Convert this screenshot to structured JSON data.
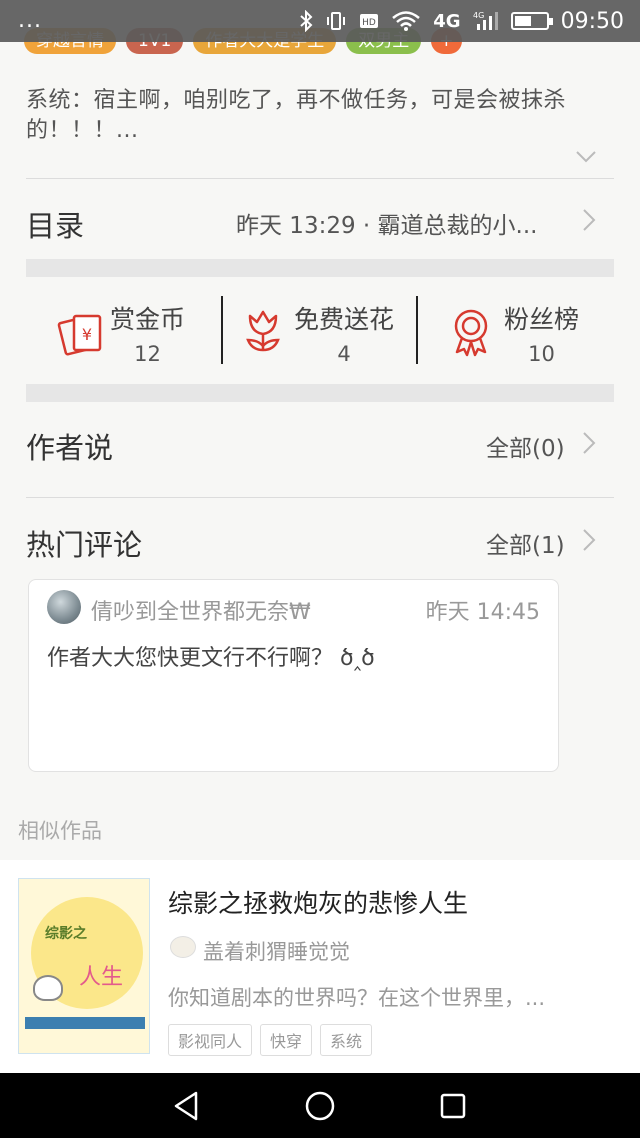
{
  "status_bar": {
    "dots": "...",
    "network_1": "4G",
    "network_2": "4G",
    "time": "09:50"
  },
  "tags": [
    {
      "label": "穿越言情",
      "color": "#f0a33a"
    },
    {
      "label": "1V1",
      "color": "#c9654f"
    },
    {
      "label": "作者大大是学生",
      "color": "#e8a63a"
    },
    {
      "label": "双男主",
      "color": "#8bbf4c"
    },
    {
      "label": "+",
      "color": "#f06a3a"
    }
  ],
  "summary": "系统：宿主啊，咱别吃了，再不做任务，可是会被抹杀的！！！...",
  "toc": {
    "label": "目录",
    "latest": "昨天 13:29 · 霸道总裁的小..."
  },
  "stats": [
    {
      "label": "赏金币",
      "value": "12",
      "icon": "red-envelope-icon"
    },
    {
      "label": "免费送花",
      "value": "4",
      "icon": "flower-icon"
    },
    {
      "label": "粉丝榜",
      "value": "10",
      "icon": "medal-icon"
    }
  ],
  "author_says": {
    "label": "作者说",
    "link": "全部(0)"
  },
  "hot_comments": {
    "label": "热门评论",
    "link": "全部(1)"
  },
  "comment": {
    "user": "倩吵到全世界都无奈₩",
    "time": "昨天 14:45",
    "text": "作者大大您快更文行不行啊？ ծ‸ծ"
  },
  "similar": {
    "section_title": "相似作品",
    "book": {
      "title": "综影之拯救炮灰的悲惨人生",
      "author": "盖着刺猬睡觉觉",
      "desc": "你知道剧本的世界吗？在这个世界里，...",
      "tags": [
        "影视同人",
        "快穿",
        "系统"
      ],
      "cover_text_1": "综影之",
      "cover_text_2": "人生"
    }
  },
  "colors": {
    "accent_red": "#d63a2f",
    "divider": "#dcdcdc"
  }
}
